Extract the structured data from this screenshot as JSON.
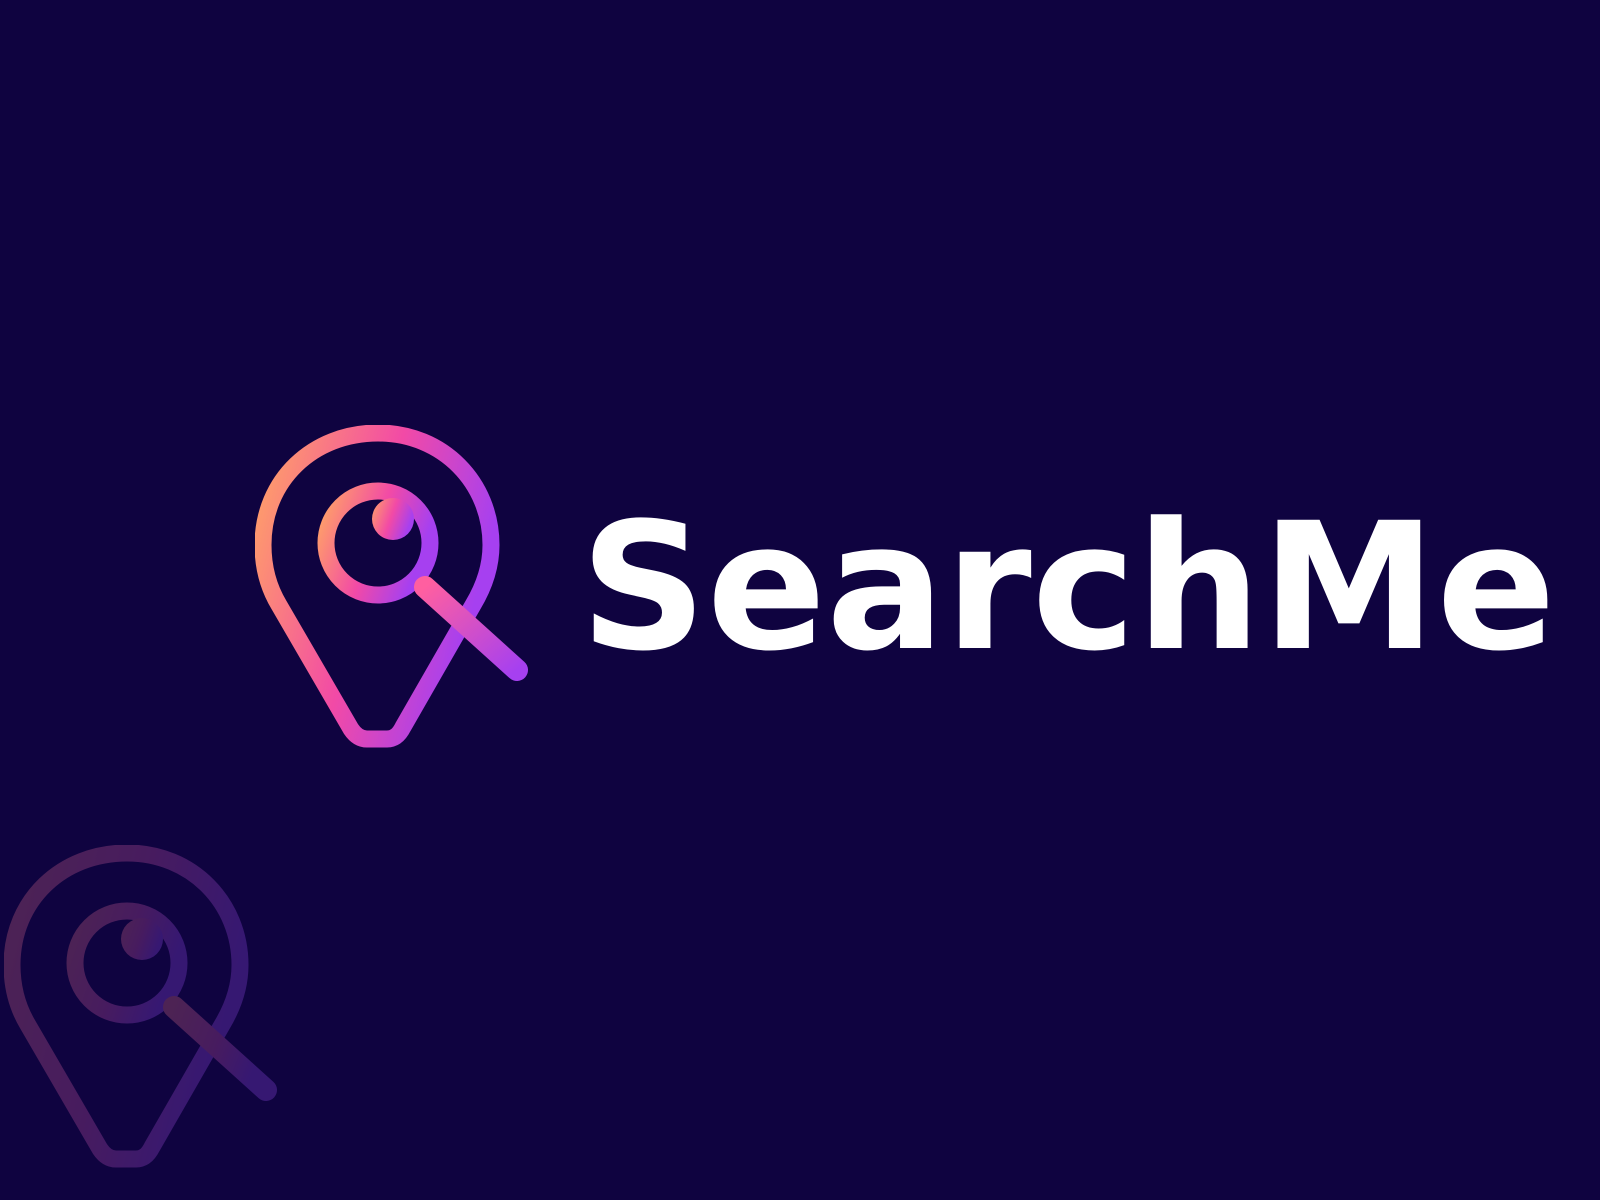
{
  "brand": {
    "name": "SearchMe",
    "colors": {
      "background": "#0f0340",
      "wordmark": "#ffffff",
      "gradient_start": "#ffa366",
      "gradient_mid": "#f24aa6",
      "gradient_end": "#a640f0"
    },
    "icons": {
      "primary": "map-pin-magnifier-icon",
      "watermark": "map-pin-magnifier-icon"
    }
  }
}
